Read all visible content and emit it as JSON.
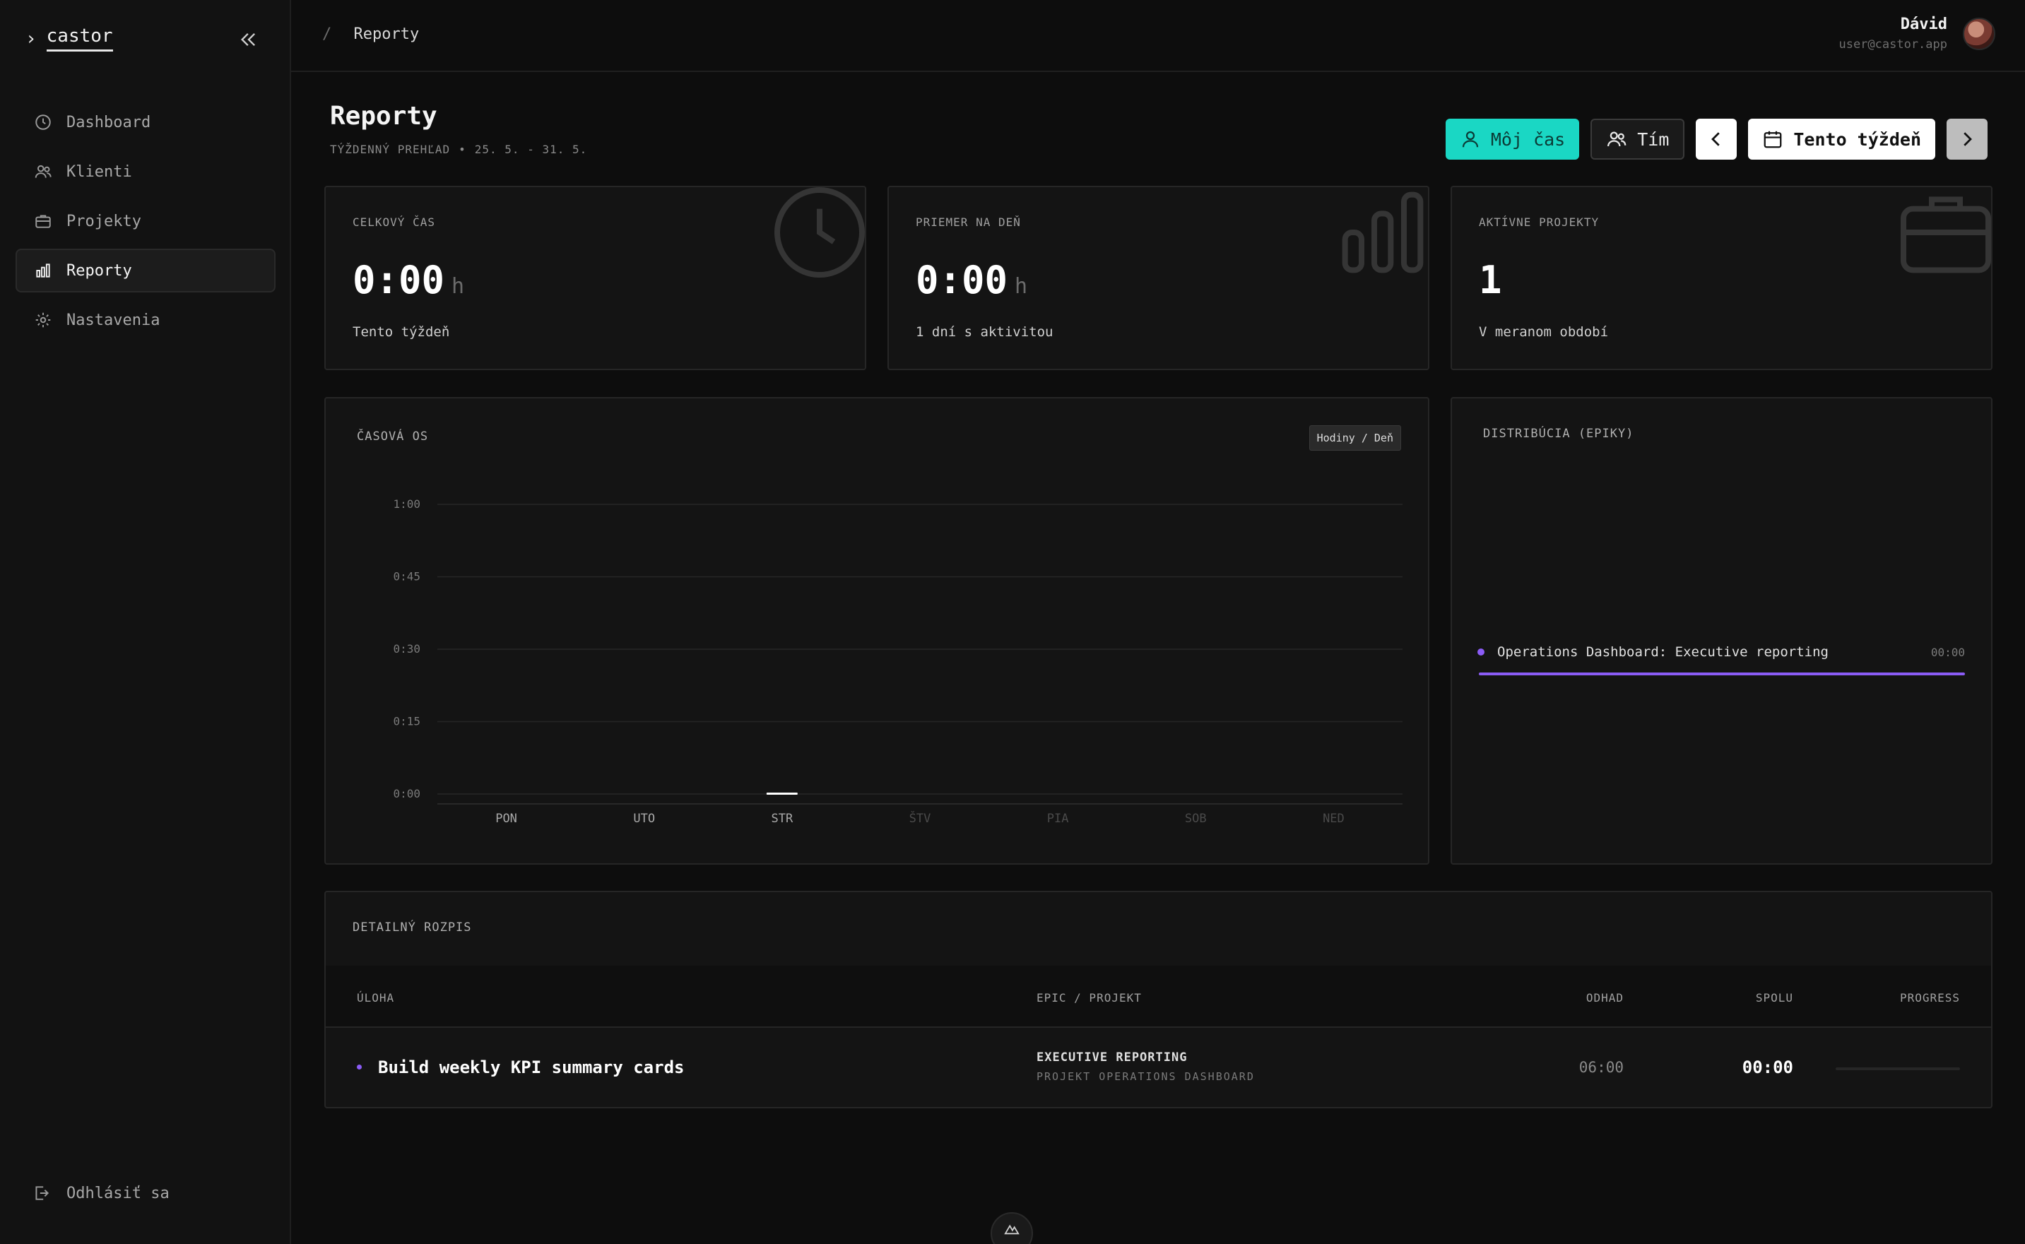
{
  "sidebar": {
    "brand": "castor",
    "items": [
      {
        "label": "Dashboard",
        "icon": "clock-icon"
      },
      {
        "label": "Klienti",
        "icon": "users-icon"
      },
      {
        "label": "Projekty",
        "icon": "briefcase-icon"
      },
      {
        "label": "Reporty",
        "icon": "bar-chart-icon",
        "active": true
      },
      {
        "label": "Nastavenia",
        "icon": "gear-icon"
      }
    ],
    "logout": "Odhlásiť sa"
  },
  "header": {
    "breadcrumb_sep": "/",
    "breadcrumb": "Reporty",
    "user_name": "Dávid",
    "user_email": "user@castor.app"
  },
  "page": {
    "title": "Reporty",
    "subtitle_label": "TÝŽDENNÝ PREHĽAD",
    "subtitle_dot": "•",
    "subtitle_range": "25. 5. - 31. 5."
  },
  "toolbar": {
    "my_time": "Môj čas",
    "team": "Tím",
    "period": "Tento týždeň"
  },
  "stats": {
    "total": {
      "label": "CELKOVÝ ČAS",
      "value": "0:00",
      "unit": "h",
      "note": "Tento týždeň"
    },
    "avg": {
      "label": "PRIEMER NA DEŇ",
      "value": "0:00",
      "unit": "h",
      "note": "1 dní s aktivitou"
    },
    "projects": {
      "label": "AKTÍVNE PROJEKTY",
      "value": "1",
      "note": "V meranom období"
    }
  },
  "timeline": {
    "title": "ČASOVÁ OS",
    "badge": "Hodiny / Deň"
  },
  "chart_data": {
    "type": "bar",
    "categories": [
      "PON",
      "UTO",
      "STR",
      "ŠTV",
      "PIA",
      "SOB",
      "NED"
    ],
    "values": [
      0,
      0,
      0,
      0,
      0,
      0,
      0
    ],
    "ylim": [
      0,
      1
    ],
    "yticks": [
      "0:00",
      "0:15",
      "0:30",
      "0:45",
      "1:00"
    ],
    "grid": true,
    "active_category": "STR",
    "dim_categories": [
      "ŠTV",
      "PIA",
      "SOB",
      "NED"
    ]
  },
  "distribution": {
    "title": "DISTRIBÚCIA (EPIKY)",
    "items": [
      {
        "name": "Operations Dashboard: Executive reporting",
        "value": "00:00",
        "color": "#8b5cf6"
      }
    ]
  },
  "detail": {
    "title": "DETAILNÝ ROZPIS",
    "columns": {
      "task": "ÚLOHA",
      "epic": "EPIC / PROJEKT",
      "estimate": "ODHAD",
      "total": "SPOLU",
      "progress": "PROGRESS"
    },
    "rows": [
      {
        "task": "Build weekly KPI summary cards",
        "epic": "EXECUTIVE REPORTING",
        "project": "PROJEKT OPERATIONS DASHBOARD",
        "estimate": "06:00",
        "total": "00:00",
        "progress": 0
      }
    ]
  },
  "colors": {
    "accent": "#1ad7c4",
    "epic": "#8b5cf6"
  }
}
